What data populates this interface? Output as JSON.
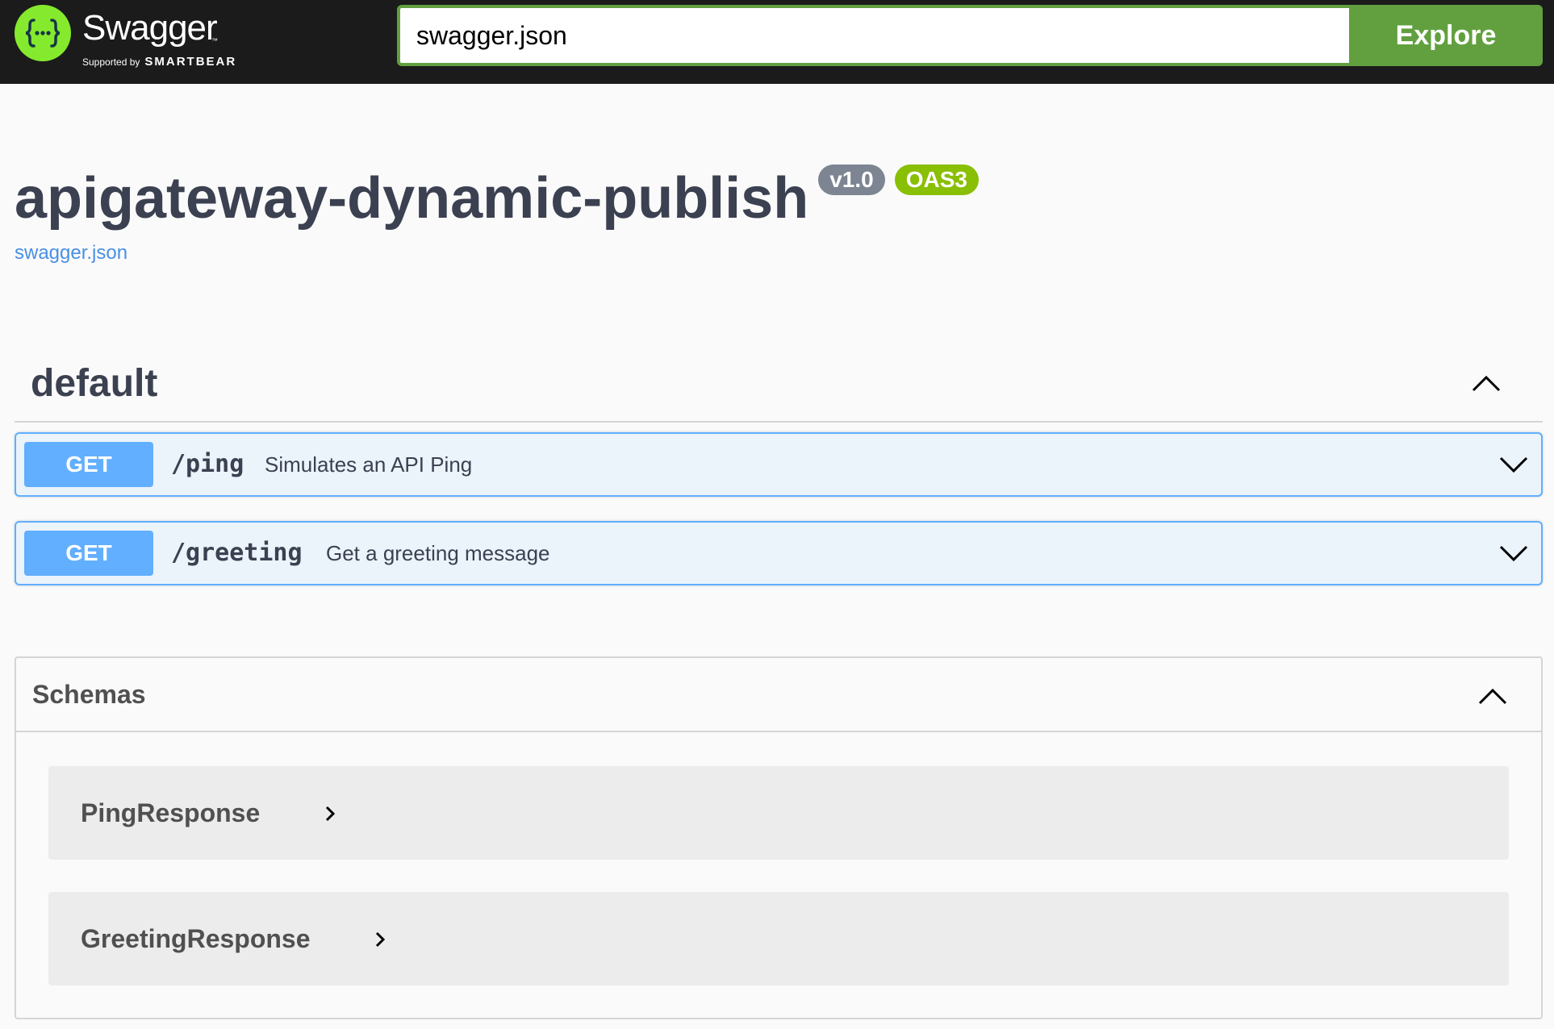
{
  "topbar": {
    "logo_text": "Swagger",
    "logo_tm": "™",
    "supported_by": "Supported by",
    "brand": "SMARTBEAR",
    "search_value": "swagger.json",
    "explore_label": "Explore"
  },
  "info": {
    "title": "apigateway-dynamic-publish",
    "version_badge": "v1.0",
    "oas_badge": "OAS3",
    "spec_link": "swagger.json"
  },
  "tag": {
    "name": "default",
    "operations": [
      {
        "method": "GET",
        "path": "/ping",
        "summary": "Simulates an API Ping"
      },
      {
        "method": "GET",
        "path": "/greeting",
        "summary": "Get a greeting message"
      }
    ]
  },
  "schemas": {
    "title": "Schemas",
    "models": [
      {
        "name": "PingResponse"
      },
      {
        "name": "GreetingResponse"
      }
    ]
  },
  "colors": {
    "topbar_bg": "#1b1b1b",
    "brand_green": "#62a03f",
    "logo_green": "#85ea2d",
    "get_blue": "#61affe",
    "get_bg": "#ebf3fb",
    "oas_green": "#89bf04",
    "version_gray": "#7d8492",
    "link_blue": "#4990e2"
  },
  "icons": {
    "logo": "swagger-braces-icon",
    "collapse": "chevron-up-icon",
    "expand": "chevron-down-icon",
    "model_expand": "chevron-right-icon"
  }
}
